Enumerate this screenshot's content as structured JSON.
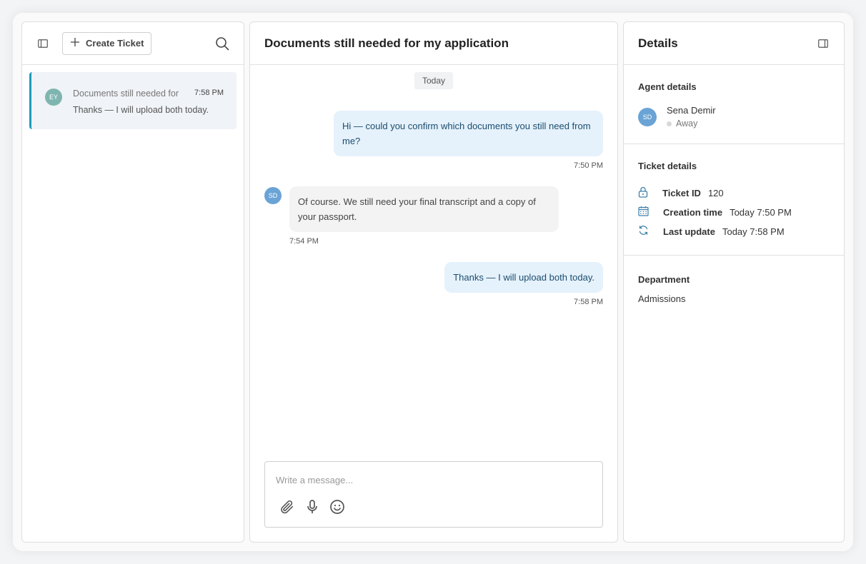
{
  "left": {
    "create_label": "Create Ticket",
    "tickets": [
      {
        "avatar": "EY",
        "title": "Documents still needed for my application",
        "time": "7:58 PM",
        "preview": "Thanks — I will upload both today."
      }
    ]
  },
  "conversation": {
    "title": "Documents still needed for my application",
    "day_label": "Today",
    "messages": [
      {
        "direction": "out",
        "text": "Hi — could you confirm which documents you still need from me?",
        "time": "7:50 PM"
      },
      {
        "direction": "in",
        "avatar": "SD",
        "text": "Of course. We still need your final transcript and a copy of your passport.",
        "time": "7:54 PM"
      },
      {
        "direction": "out",
        "text": "Thanks — I will upload both today.",
        "time": "7:58 PM"
      }
    ],
    "composer": {
      "placeholder": "Write a message...",
      "value": ""
    }
  },
  "details": {
    "title": "Details",
    "agent_section_title": "Agent details",
    "agent": {
      "initials": "SD",
      "name": "Sena Demir",
      "status": "Away"
    },
    "ticket_section_title": "Ticket details",
    "ticket_id_label": "Ticket ID",
    "ticket_id": "120",
    "creation_label": "Creation time",
    "creation_value": "Today 7:50 PM",
    "update_label": "Last update",
    "update_value": "Today 7:58 PM",
    "department_title": "Department",
    "department": "Admissions"
  },
  "colors": {
    "accent": "#1e9bb8",
    "outgoing_bubble": "#e5f1fb",
    "incoming_bubble": "#f3f3f3",
    "agent_avatar": "#6aa3d5",
    "customer_avatar": "#7fb5b0"
  },
  "icons": [
    "sidebar-toggle-icon",
    "plus-icon",
    "search-icon",
    "paperclip-icon",
    "microphone-icon",
    "emoji-icon",
    "lock-icon",
    "calendar-icon",
    "refresh-icon",
    "panel-collapse-icon"
  ]
}
